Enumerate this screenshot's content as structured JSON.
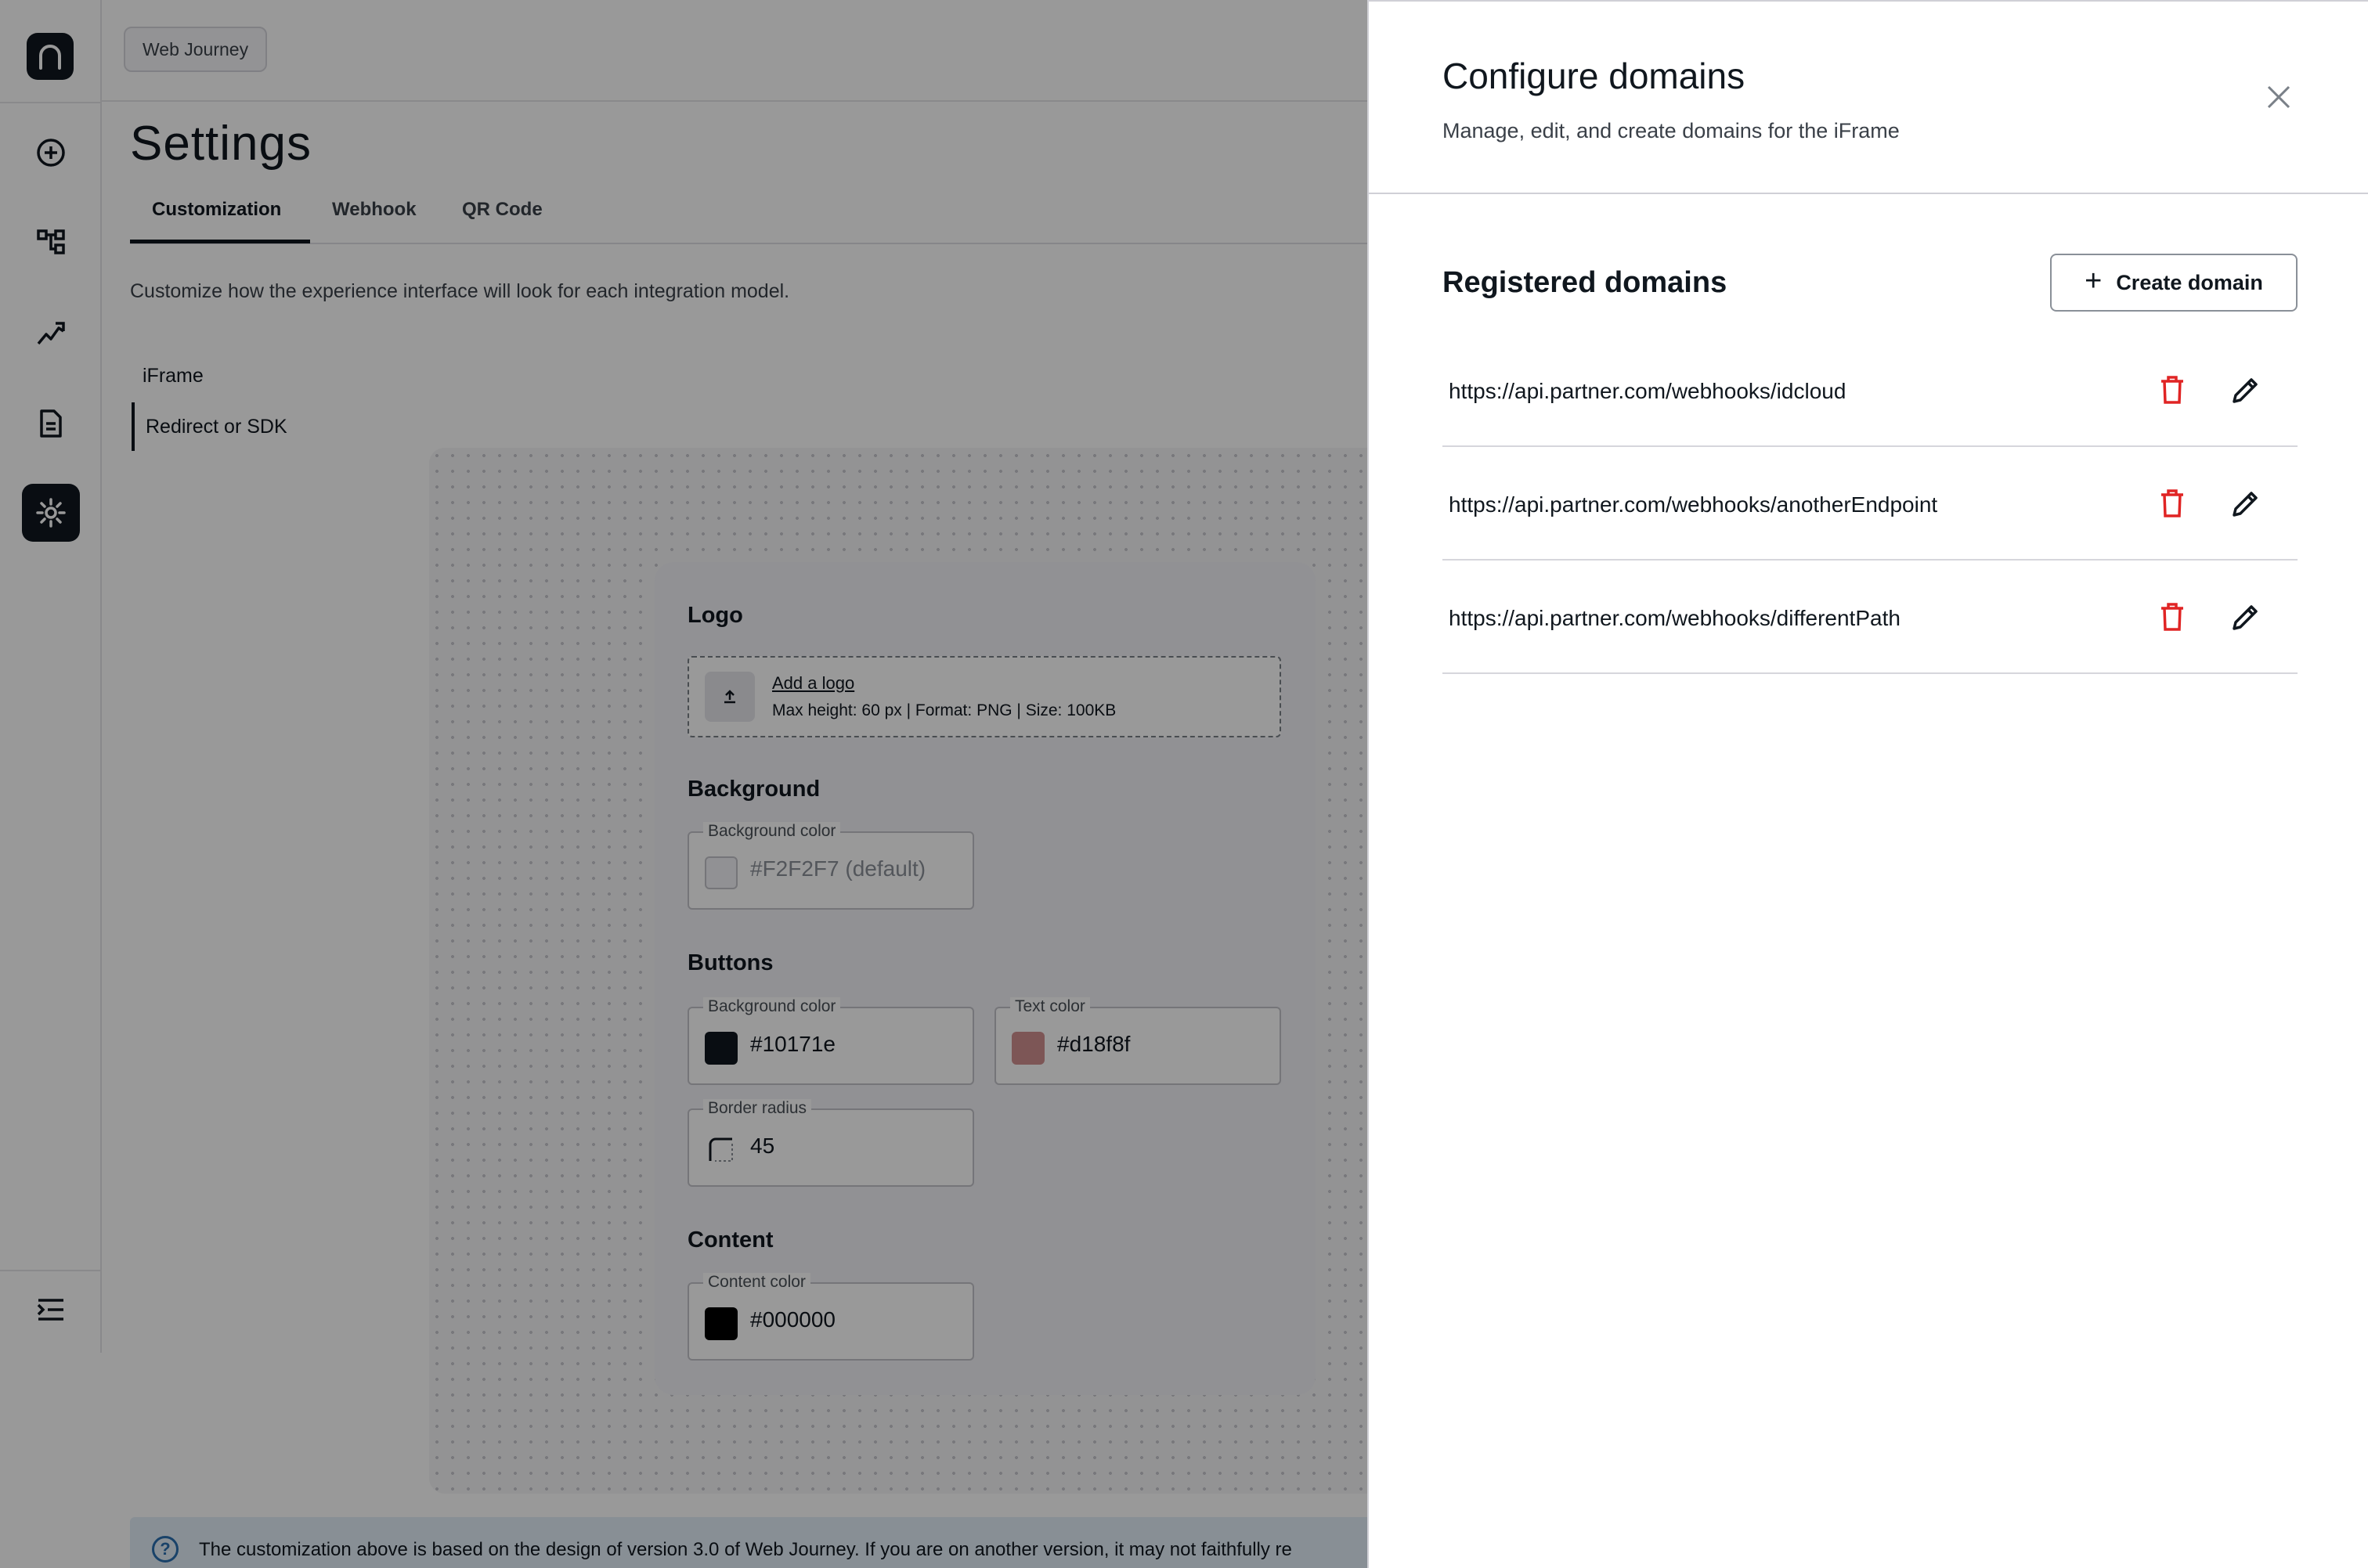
{
  "colors": {
    "primary": "#10171e",
    "danger": "#e02424",
    "accent": "#2a6fb0"
  },
  "topbar": {
    "chip_label": "Web Journey"
  },
  "sidebar": {
    "items": [
      {
        "icon": "plus-circle-icon"
      },
      {
        "icon": "flow-icon"
      },
      {
        "icon": "analytics-icon"
      },
      {
        "icon": "document-icon"
      },
      {
        "icon": "gear-icon",
        "active": true
      }
    ],
    "collapse_icon": "menu-collapse-icon"
  },
  "page": {
    "title": "Settings",
    "tabs": [
      {
        "label": "Customization",
        "active": true
      },
      {
        "label": "Webhook"
      },
      {
        "label": "QR Code"
      }
    ],
    "intro": "Customize how the experience interface will look for each integration model.",
    "subnav": [
      {
        "label": "iFrame"
      },
      {
        "label": "Redirect or SDK",
        "active": true
      }
    ]
  },
  "preview": {
    "logo": {
      "heading": "Logo",
      "add_link": "Add a logo",
      "hint": "Max height: 60 px | Format: PNG | Size: 100KB"
    },
    "background": {
      "heading": "Background",
      "field_label": "Background color",
      "value": "#F2F2F7 (default)",
      "swatch": "#f2f2f7"
    },
    "buttons": {
      "heading": "Buttons",
      "bg_label": "Background color",
      "bg_value": "#10171e",
      "text_label": "Text color",
      "text_value": "#d18f8f",
      "radius_label": "Border radius",
      "radius_value": "45"
    },
    "content": {
      "heading": "Content",
      "field_label": "Content color",
      "value": "#000000"
    }
  },
  "banner": {
    "text": "The customization above is based on the design of version 3.0 of Web Journey. If you are on another version, it may not faithfully re"
  },
  "drawer": {
    "title": "Configure domains",
    "subtitle": "Manage, edit, and create domains for the iFrame",
    "section_title": "Registered domains",
    "create_label": "Create domain",
    "domains": [
      {
        "url": "https://api.partner.com/webhooks/idcloud"
      },
      {
        "url": "https://api.partner.com/webhooks/anotherEndpoint"
      },
      {
        "url": "https://api.partner.com/webhooks/differentPath"
      }
    ]
  }
}
